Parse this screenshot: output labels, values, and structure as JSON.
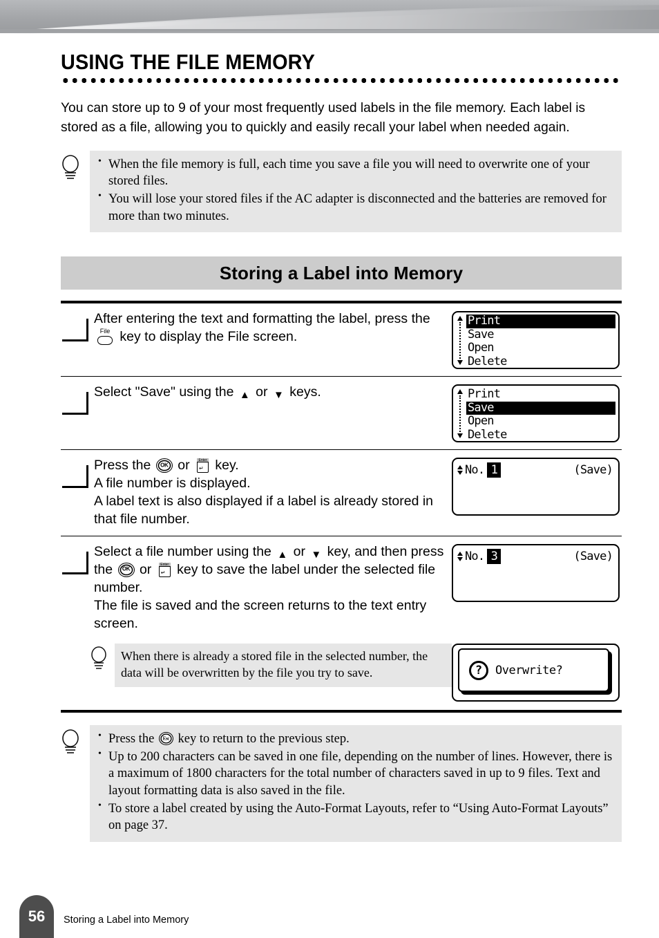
{
  "chapter": {
    "title": "USING THE FILE MEMORY",
    "intro": "You can store up to 9 of your most frequently used labels in the file memory. Each label is stored as a file, allowing you to quickly and easily recall your label when needed again."
  },
  "top_note": {
    "icon": "lightbulb-icon",
    "items": [
      "When the file memory is full, each time you save a file you will need to overwrite one of your stored files.",
      "You will lose your stored files if the AC adapter is disconnected and the batteries are removed for more than two minutes."
    ]
  },
  "section": {
    "heading": "Storing a Label into Memory"
  },
  "steps": [
    {
      "number": "",
      "text_parts": {
        "a": "After entering the text and formatting the label, press the",
        "key": "File",
        "b": "key to display the File screen."
      },
      "lcd": {
        "type": "menu",
        "scroll": true,
        "rows": [
          {
            "label": "Print",
            "selected": true
          },
          {
            "label": "Save",
            "selected": false
          },
          {
            "label": "Open",
            "selected": false
          },
          {
            "label": "Delete",
            "selected": false
          }
        ]
      }
    },
    {
      "number": "",
      "text_parts": {
        "a": "Select \"Save\" using the",
        "up": "▲",
        "mid": "or",
        "down": "▼",
        "b": "keys."
      },
      "lcd": {
        "type": "menu",
        "scroll": true,
        "rows": [
          {
            "label": "Print",
            "selected": false
          },
          {
            "label": "Save",
            "selected": true
          },
          {
            "label": "Open",
            "selected": false
          },
          {
            "label": "Delete",
            "selected": false
          }
        ]
      }
    },
    {
      "number": "",
      "text_parts": {
        "a": "Press the",
        "ok": "OK",
        "mid": "or",
        "enter": "Enter",
        "b": "key.",
        "line2": "A file number is displayed.",
        "line3": "A label text is also displayed if a label is already stored in that file number."
      },
      "lcd": {
        "type": "filenumber",
        "prefix": "No.",
        "value": "1",
        "mode": "(Save)"
      }
    },
    {
      "number": "",
      "text_parts": {
        "a": "Select a file number using the",
        "up": "▲",
        "mid": "or",
        "down": "▼",
        "b": "key, and then press the",
        "ok": "OK",
        "mid2": "or",
        "enter": "Enter",
        "c": "key to save the label under the selected file number.",
        "line2": "The file is saved and the screen returns to the text entry screen."
      },
      "lcd": {
        "type": "filenumber",
        "prefix": "No.",
        "value": "3",
        "mode": "(Save)"
      },
      "inner_note": {
        "icon": "lightbulb-icon",
        "text": "When there is already a stored file in the selected number, the data will be overwritten by the file you try to save."
      },
      "inner_lcd": {
        "type": "dialog",
        "icon": "question-mark-icon",
        "text": "Overwrite?"
      }
    }
  ],
  "bottom_note": {
    "icon": "lightbulb-icon",
    "items": [
      {
        "a": "Press the",
        "key": "Esc",
        "b": "key to return to the previous step."
      },
      {
        "a": "Up to 200 characters can be saved in one file, depending on the number of lines. However, there is a maximum of 1800 characters for the total number of characters saved in up to 9 files. Text and layout formatting data is also saved in the file."
      },
      {
        "a": "To store a label created by using the Auto-Format Layouts, refer to “Using Auto-Format Layouts” on page 37."
      }
    ]
  },
  "footer": {
    "page_number": "56",
    "title": "Storing a Label into Memory"
  },
  "colors": {
    "note_bg": "#e6e6e6",
    "section_bar_bg": "#cccccc",
    "page_tab_bg": "#4d4d4d",
    "banner_gray": "#a6a8ab"
  }
}
